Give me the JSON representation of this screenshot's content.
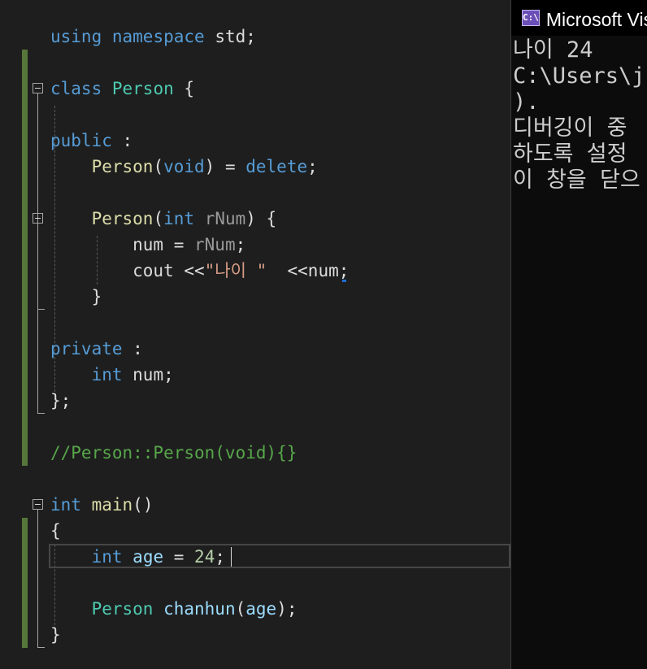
{
  "editor": {
    "lines": [
      [
        {
          "t": "using",
          "c": "kw"
        },
        {
          "t": " ",
          "c": "plain"
        },
        {
          "t": "namespace",
          "c": "kw"
        },
        {
          "t": " std;",
          "c": "plain"
        }
      ],
      [],
      [
        {
          "t": "class",
          "c": "kw"
        },
        {
          "t": " ",
          "c": "plain"
        },
        {
          "t": "Person",
          "c": "type"
        },
        {
          "t": " {",
          "c": "plain"
        }
      ],
      [],
      [
        {
          "t": "public",
          "c": "kw"
        },
        {
          "t": " :",
          "c": "plain"
        }
      ],
      [
        {
          "t": "    ",
          "c": "plain"
        },
        {
          "t": "Person",
          "c": "fn"
        },
        {
          "t": "(",
          "c": "plain"
        },
        {
          "t": "void",
          "c": "kw"
        },
        {
          "t": ") = ",
          "c": "plain"
        },
        {
          "t": "delete",
          "c": "kw"
        },
        {
          "t": ";",
          "c": "plain"
        }
      ],
      [],
      [
        {
          "t": "    ",
          "c": "plain"
        },
        {
          "t": "Person",
          "c": "fn"
        },
        {
          "t": "(",
          "c": "plain"
        },
        {
          "t": "int",
          "c": "kw"
        },
        {
          "t": " ",
          "c": "plain"
        },
        {
          "t": "rNum",
          "c": "param"
        },
        {
          "t": ") {",
          "c": "plain"
        }
      ],
      [
        {
          "t": "        num = ",
          "c": "plain"
        },
        {
          "t": "rNum",
          "c": "param"
        },
        {
          "t": ";",
          "c": "plain"
        }
      ],
      [
        {
          "t": "        cout <<",
          "c": "plain"
        },
        {
          "t": "\"나이 \"",
          "c": "str"
        },
        {
          "t": "  <<num;",
          "c": "plain"
        }
      ],
      [
        {
          "t": "    }",
          "c": "plain"
        }
      ],
      [],
      [
        {
          "t": "private",
          "c": "kw"
        },
        {
          "t": " :",
          "c": "plain"
        }
      ],
      [
        {
          "t": "    ",
          "c": "plain"
        },
        {
          "t": "int",
          "c": "kw"
        },
        {
          "t": " num;",
          "c": "plain"
        }
      ],
      [
        {
          "t": "};",
          "c": "plain"
        }
      ],
      [],
      [
        {
          "t": "//Person::Person(void){}",
          "c": "cmt"
        }
      ],
      [],
      [
        {
          "t": "int",
          "c": "kw"
        },
        {
          "t": " ",
          "c": "plain"
        },
        {
          "t": "main",
          "c": "fn"
        },
        {
          "t": "()",
          "c": "plain"
        }
      ],
      [
        {
          "t": "{",
          "c": "plain"
        }
      ],
      [
        {
          "t": "    ",
          "c": "plain"
        },
        {
          "t": "int",
          "c": "kw"
        },
        {
          "t": " ",
          "c": "plain"
        },
        {
          "t": "age",
          "c": "var"
        },
        {
          "t": " = ",
          "c": "plain"
        },
        {
          "t": "24",
          "c": "num"
        },
        {
          "t": ";",
          "c": "plain"
        }
      ],
      [],
      [
        {
          "t": "    ",
          "c": "plain"
        },
        {
          "t": "Person",
          "c": "type"
        },
        {
          "t": " ",
          "c": "plain"
        },
        {
          "t": "chanhun",
          "c": "var"
        },
        {
          "t": "(",
          "c": "plain"
        },
        {
          "t": "age",
          "c": "var"
        },
        {
          "t": ");",
          "c": "plain"
        }
      ],
      [
        {
          "t": "}",
          "c": "plain"
        }
      ]
    ]
  },
  "console": {
    "title": "Microsoft Visual Studio 디버그 콘솔",
    "icon_text": "C:\\",
    "output_lines": [
      "나이 24",
      "C:\\Users\\jc",
      ").",
      "디버깅이 중",
      "하도록 설정",
      "이 창을 닫으"
    ]
  },
  "colors": {
    "background": "#1e1e1e",
    "keyword": "#569cd6",
    "type": "#4ec9b0",
    "function": "#dcdcaa",
    "string": "#d69d85",
    "number": "#b5cea8",
    "comment": "#57a64a",
    "variable": "#9cdcfe",
    "change_bar": "#57773a",
    "console_bg": "#0c0c0c"
  }
}
